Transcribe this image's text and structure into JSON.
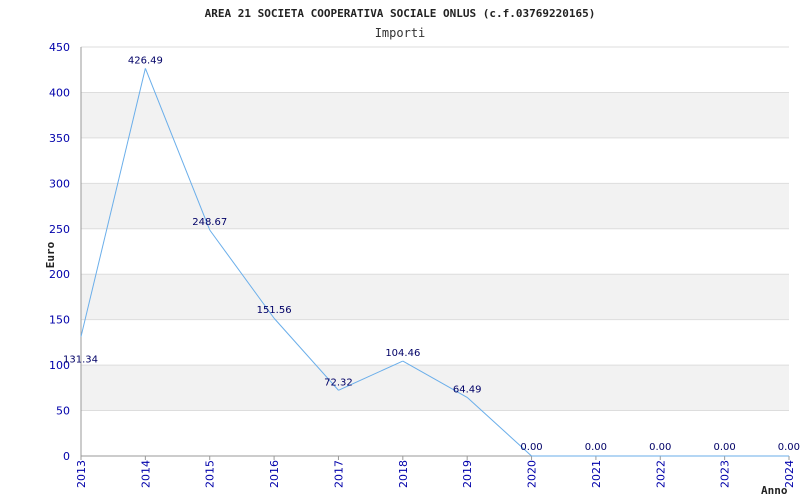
{
  "chart_data": {
    "type": "line",
    "title": "AREA 21 SOCIETA COOPERATIVA SOCIALE ONLUS (c.f.03769220165)",
    "subtitle": "Importi",
    "xlabel": "Anno",
    "ylabel": "Euro",
    "x": [
      "2013",
      "2014",
      "2015",
      "2016",
      "2017",
      "2018",
      "2019",
      "2020",
      "2021",
      "2022",
      "2023",
      "2024"
    ],
    "series": [
      {
        "values": [
          131.34,
          426.49,
          248.67,
          151.56,
          72.32,
          104.46,
          64.49,
          0.0,
          0.0,
          0.0,
          0.0,
          0.0
        ],
        "labels": [
          "131.34",
          "426.49",
          "248.67",
          "151.56",
          "72.32",
          "104.46",
          "64.49",
          "0.00",
          "0.00",
          "0.00",
          "0.00",
          "0.00"
        ]
      }
    ],
    "ylim": [
      0,
      450
    ],
    "yticks": [
      "0",
      "50",
      "100",
      "150",
      "200",
      "250",
      "300",
      "350",
      "400",
      "450"
    ],
    "grid": "horizontal, alternating bands",
    "colors": {
      "line": "#6aaeea",
      "band": "#f2f2f2",
      "grid": "#dddddd",
      "tick_text": "#0000aa",
      "data_label": "#000066"
    }
  }
}
